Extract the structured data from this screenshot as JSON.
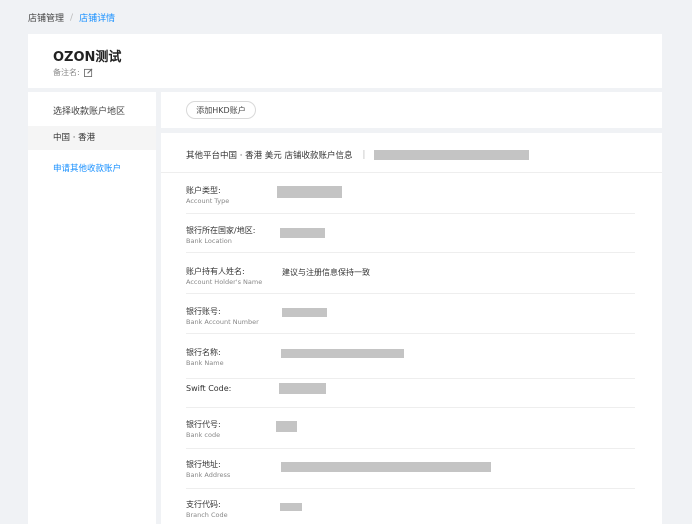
{
  "breadcrumb": {
    "root": "店铺管理",
    "separator": "/",
    "current": "店铺详情"
  },
  "shop": {
    "name": "OZON测试",
    "remark_label": "备注名:"
  },
  "sidebar": {
    "title": "选择收款账户地区",
    "active_region": "中国 · 香港",
    "apply_link": "申请其他收款账户"
  },
  "toolbar": {
    "add_button": "添加HKD账户"
  },
  "panel": {
    "header_text": "其他平台中国 · 香港 美元 店铺收款账户信息",
    "header_sep": "|",
    "fields": [
      {
        "cn": "账户类型:",
        "en": "Account Type",
        "value": ""
      },
      {
        "cn": "银行所在国家/地区:",
        "en": "Bank Location",
        "value": ""
      },
      {
        "cn": "账户持有人姓名:",
        "en": "Account Holder's Name",
        "value": "建议与注册信息保持一致"
      },
      {
        "cn": "银行账号:",
        "en": "Bank Account Number",
        "value": ""
      },
      {
        "cn": "银行名称:",
        "en": "Bank Name",
        "value": ""
      },
      {
        "cn": "Swift Code:",
        "en": "",
        "value": ""
      },
      {
        "cn": "银行代号:",
        "en": "Bank code",
        "value": ""
      },
      {
        "cn": "银行地址:",
        "en": "Bank Address",
        "value": ""
      },
      {
        "cn": "支行代码:",
        "en": "Branch Code",
        "value": ""
      }
    ]
  },
  "colors": {
    "accent": "#1890ff",
    "background": "#f0f2f5",
    "redacted": "#c4c4c4"
  }
}
